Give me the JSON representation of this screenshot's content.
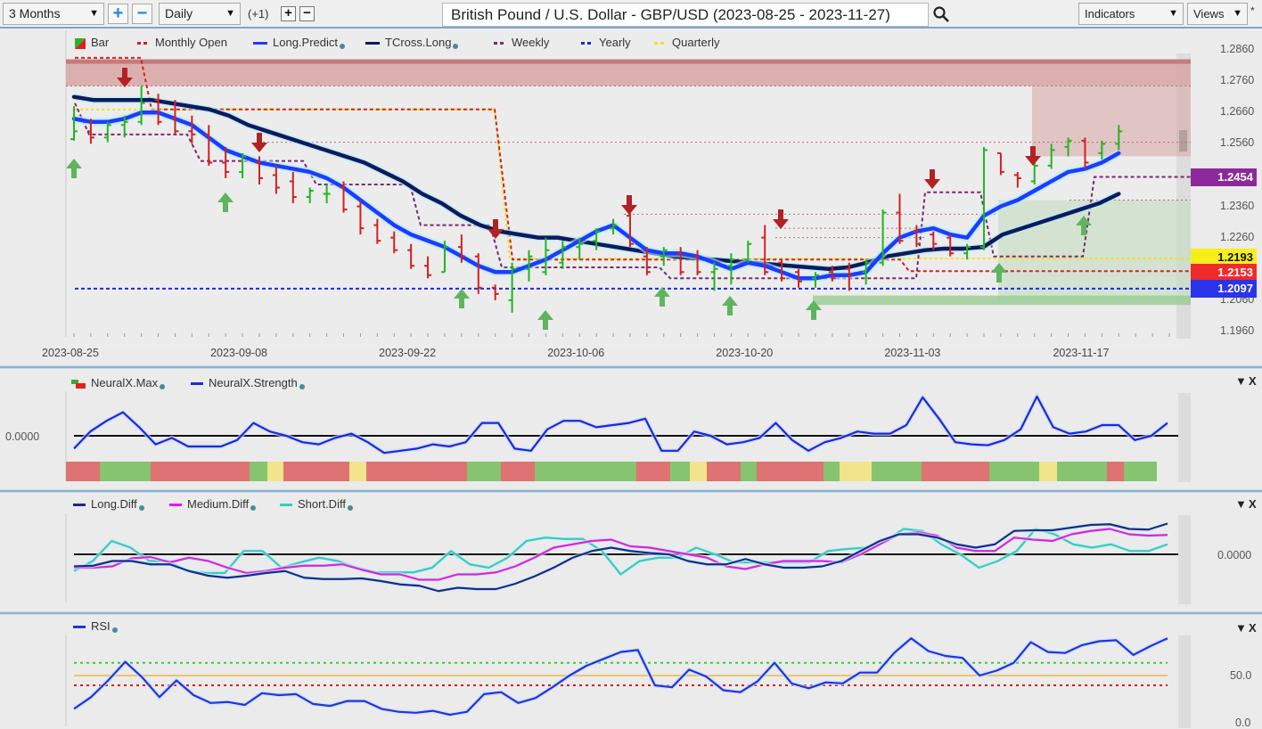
{
  "toolbar": {
    "range_select": "3 Months",
    "interval_select": "Daily",
    "offset_label": "(+1)",
    "title": "British Pound / U.S. Dollar - GBP/USD (2023-08-25 - 2023-11-27)",
    "indicators_label": "Indicators",
    "views_label": "Views",
    "star": "*",
    "plus": "+",
    "minus": "−"
  },
  "colors": {
    "bar_up": "#22b522",
    "bar_down": "#d42020",
    "long_predict": "#1e3cff",
    "tcross_long": "#0e1a5e",
    "monthly_open": "#d42020",
    "weekly": "#7a2a6e",
    "yearly": "#1a2ad8",
    "quarterly": "#f2e21a",
    "neural_green": "#86c46f",
    "neural_red": "#df7272",
    "neural_yellow": "#f1e48a",
    "long_diff": "#1a2a8a",
    "medium_diff": "#e020e0",
    "short_diff": "#3cc8c0",
    "rsi": "#2233dd"
  },
  "main_legend": [
    {
      "label": "Bar",
      "kind": "bar"
    },
    {
      "label": "Monthly Open",
      "kind": "dash",
      "color": "#d42020"
    },
    {
      "label": "Long.Predict",
      "kind": "line",
      "color": "#1e3cff",
      "dot": true
    },
    {
      "label": "TCross.Long",
      "kind": "line",
      "color": "#0e1a5e",
      "dot": true
    },
    {
      "label": "Weekly",
      "kind": "dash",
      "color": "#7a2a6e"
    },
    {
      "label": "Yearly",
      "kind": "dash",
      "color": "#1a2ad8"
    },
    {
      "label": "Quarterly",
      "kind": "dash",
      "color": "#f2e21a"
    }
  ],
  "price_tags": [
    {
      "value": "1.2454",
      "bg": "#8c2a9c",
      "fg": "#ffffff"
    },
    {
      "value": "1.2193",
      "bg": "#f8ee1a",
      "fg": "#111111"
    },
    {
      "value": "1.2153",
      "bg": "#ee2a2a",
      "fg": "#ffffff"
    },
    {
      "value": "1.2097",
      "bg": "#2a34e8",
      "fg": "#ffffff"
    }
  ],
  "neural_legend": [
    {
      "label": "NeuralX.Max",
      "kind": "max"
    },
    {
      "label": "NeuralX.Strength",
      "kind": "line",
      "color": "#1a2ad8"
    }
  ],
  "diff_legend": [
    {
      "label": "Long.Diff",
      "color": "#1a2a8a"
    },
    {
      "label": "Medium.Diff",
      "color": "#e020e0"
    },
    {
      "label": "Short.Diff",
      "color": "#3cc8c0"
    }
  ],
  "rsi_legend": [
    {
      "label": "RSI",
      "color": "#2233dd"
    }
  ],
  "panel_controls": {
    "collapse": "▼",
    "close": "X"
  },
  "chart_data": [
    {
      "type": "ohlc",
      "title": "British Pound / U.S. Dollar - GBP/USD (2023-08-25 - 2023-11-27)",
      "ylim": [
        1.192,
        1.29
      ],
      "yticks": [
        "1.2860",
        "1.2760",
        "1.2660",
        "1.2560",
        "1.2454",
        "1.2360",
        "1.2260",
        "1.2193",
        "1.2153",
        "1.2097",
        "1.2060",
        "1.1960"
      ],
      "ytick_values": [
        1.286,
        1.276,
        1.266,
        1.256,
        1.236,
        1.226,
        1.206,
        1.196
      ],
      "xticks": [
        "2023-08-25",
        "2023-09-08",
        "2023-09-22",
        "2023-10-06",
        "2023-10-20",
        "2023-11-03",
        "2023-11-17"
      ],
      "xtick_index": [
        0,
        10,
        20,
        30,
        40,
        50,
        60
      ],
      "n_bars": 66,
      "bars": [
        [
          1.2575,
          1.268,
          1.257,
          1.26
        ],
        [
          1.26,
          1.264,
          1.256,
          1.258
        ],
        [
          1.258,
          1.263,
          1.2565,
          1.262
        ],
        [
          1.262,
          1.265,
          1.258,
          1.263
        ],
        [
          1.263,
          1.2745,
          1.262,
          1.269
        ],
        [
          1.27,
          1.272,
          1.262,
          1.263
        ],
        [
          1.264,
          1.27,
          1.259,
          1.26
        ],
        [
          1.26,
          1.265,
          1.256,
          1.259
        ],
        [
          1.259,
          1.262,
          1.249,
          1.25
        ],
        [
          1.25,
          1.255,
          1.245,
          1.247
        ],
        [
          1.247,
          1.253,
          1.245,
          1.252
        ],
        [
          1.25,
          1.252,
          1.243,
          1.245
        ],
        [
          1.246,
          1.249,
          1.24,
          1.242
        ],
        [
          1.244,
          1.247,
          1.237,
          1.239
        ],
        [
          1.239,
          1.242,
          1.237,
          1.241
        ],
        [
          1.24,
          1.243,
          1.237,
          1.24
        ],
        [
          1.242,
          1.244,
          1.234,
          1.235
        ],
        [
          1.236,
          1.238,
          1.227,
          1.229
        ],
        [
          1.23,
          1.232,
          1.224,
          1.225
        ],
        [
          1.226,
          1.228,
          1.221,
          1.222
        ],
        [
          1.222,
          1.224,
          1.216,
          1.217
        ],
        [
          1.217,
          1.22,
          1.213,
          1.214
        ],
        [
          1.215,
          1.225,
          1.215,
          1.223
        ],
        [
          1.223,
          1.227,
          1.218,
          1.22
        ],
        [
          1.22,
          1.221,
          1.208,
          1.21
        ],
        [
          1.21,
          1.211,
          1.206,
          1.208
        ],
        [
          1.206,
          1.218,
          1.202,
          1.216
        ],
        [
          1.216,
          1.222,
          1.212,
          1.22
        ],
        [
          1.215,
          1.226,
          1.214,
          1.222
        ],
        [
          1.218,
          1.225,
          1.216,
          1.223
        ],
        [
          1.223,
          1.226,
          1.219,
          1.224
        ],
        [
          1.225,
          1.229,
          1.222,
          1.228
        ],
        [
          1.229,
          1.232,
          1.227,
          1.23
        ],
        [
          1.233,
          1.236,
          1.223,
          1.224
        ],
        [
          1.22,
          1.223,
          1.214,
          1.215
        ],
        [
          1.22,
          1.223,
          1.217,
          1.222
        ],
        [
          1.221,
          1.223,
          1.214,
          1.215
        ],
        [
          1.22,
          1.222,
          1.214,
          1.215
        ],
        [
          1.215,
          1.218,
          1.209,
          1.216
        ],
        [
          1.217,
          1.221,
          1.211,
          1.219
        ],
        [
          1.219,
          1.225,
          1.218,
          1.224
        ],
        [
          1.226,
          1.23,
          1.214,
          1.215
        ],
        [
          1.218,
          1.219,
          1.212,
          1.213
        ],
        [
          1.215,
          1.216,
          1.21,
          1.212
        ],
        [
          1.213,
          1.215,
          1.21,
          1.214
        ],
        [
          1.215,
          1.217,
          1.212,
          1.213
        ],
        [
          1.216,
          1.218,
          1.209,
          1.214
        ],
        [
          1.215,
          1.219,
          1.211,
          1.218
        ],
        [
          1.218,
          1.235,
          1.217,
          1.234
        ],
        [
          1.234,
          1.24,
          1.224,
          1.225
        ],
        [
          1.228,
          1.23,
          1.223,
          1.224
        ],
        [
          1.227,
          1.228,
          1.222,
          1.224
        ],
        [
          1.226,
          1.227,
          1.22,
          1.221
        ],
        [
          1.221,
          1.224,
          1.219,
          1.223
        ],
        [
          1.223,
          1.255,
          1.222,
          1.254
        ],
        [
          1.253,
          1.253,
          1.246,
          1.247
        ],
        [
          1.246,
          1.247,
          1.242,
          1.245
        ],
        [
          1.244,
          1.25,
          1.243,
          1.249
        ],
        [
          1.249,
          1.256,
          1.248,
          1.254
        ],
        [
          1.255,
          1.258,
          1.252,
          1.257
        ],
        [
          1.257,
          1.258,
          1.248,
          1.25
        ],
        [
          1.253,
          1.257,
          1.251,
          1.256
        ],
        [
          1.256,
          1.262,
          1.254,
          1.26
        ]
      ],
      "long_predict": [
        1.264,
        1.263,
        1.263,
        1.264,
        1.266,
        1.266,
        1.264,
        1.262,
        1.258,
        1.254,
        1.252,
        1.25,
        1.249,
        1.248,
        1.247,
        1.245,
        1.242,
        1.238,
        1.234,
        1.23,
        1.227,
        1.225,
        1.223,
        1.22,
        1.217,
        1.215,
        1.215,
        1.217,
        1.219,
        1.222,
        1.225,
        1.228,
        1.23,
        1.226,
        1.222,
        1.221,
        1.221,
        1.22,
        1.218,
        1.216,
        1.218,
        1.217,
        1.215,
        1.213,
        1.213,
        1.214,
        1.214,
        1.215,
        1.221,
        1.226,
        1.228,
        1.229,
        1.227,
        1.226,
        1.233,
        1.236,
        1.238,
        1.241,
        1.244,
        1.247,
        1.248,
        1.25,
        1.253
      ],
      "tcross_long": [
        1.271,
        1.27,
        1.27,
        1.27,
        1.27,
        1.269,
        1.268,
        1.267,
        1.265,
        1.262,
        1.26,
        1.258,
        1.256,
        1.254,
        1.252,
        1.25,
        1.247,
        1.244,
        1.24,
        1.237,
        1.233,
        1.23,
        1.228,
        1.227,
        1.226,
        1.226,
        1.225,
        1.224,
        1.223,
        1.222,
        1.221,
        1.22,
        1.2195,
        1.219,
        1.2185,
        1.218,
        1.2175,
        1.217,
        1.2165,
        1.216,
        1.2165,
        1.218,
        1.22,
        1.221,
        1.222,
        1.2225,
        1.2225,
        1.223,
        1.227,
        1.229,
        1.231,
        1.233,
        1.235,
        1.237,
        1.24
      ],
      "levels": {
        "weekly": 1.2454,
        "quarterly": 1.2193,
        "monthly_open": 1.2153,
        "yearly": 1.2097
      },
      "series": [
        "Bar",
        "Monthly Open",
        "Long.Predict",
        "TCross.Long",
        "Weekly",
        "Yearly",
        "Quarterly"
      ]
    },
    {
      "type": "line+heatstrip",
      "name": "NeuralX",
      "legend": [
        "NeuralX.Max",
        "NeuralX.Strength"
      ],
      "yticks": [
        "0.0000"
      ],
      "ylim": [
        -1,
        1.5
      ],
      "strength": [
        -0.3,
        0.1,
        0.35,
        0.55,
        0.2,
        -0.2,
        -0.05,
        -0.25,
        -0.25,
        -0.25,
        -0.1,
        0.3,
        0.1,
        0.0,
        -0.15,
        -0.2,
        -0.05,
        0.05,
        -0.15,
        -0.4,
        -0.35,
        -0.3,
        -0.2,
        -0.25,
        -0.15,
        0.3,
        0.3,
        -0.3,
        -0.35,
        0.15,
        0.35,
        0.35,
        0.2,
        0.25,
        0.3,
        0.4,
        -0.35,
        -0.35,
        0.1,
        0.0,
        -0.2,
        -0.15,
        -0.05,
        0.3,
        -0.1,
        -0.35,
        -0.15,
        -0.05,
        0.1,
        0.05,
        0.05,
        0.25,
        0.9,
        0.4,
        -0.15,
        -0.2,
        -0.22,
        -0.1,
        0.15,
        0.92,
        0.2,
        0.05,
        0.1,
        0.25,
        0.25,
        -0.1,
        0.0,
        0.3
      ],
      "strip": [
        "red",
        "green",
        "red",
        "green",
        "yellow",
        "red",
        "yellow",
        "red",
        "green",
        "red",
        "green",
        "red",
        "green",
        "yellow",
        "red",
        "green",
        "red",
        "green",
        "yellow",
        "green",
        "red",
        "green",
        "yellow",
        "green",
        "red",
        "green"
      ],
      "strip_widths": [
        38,
        57,
        111,
        20,
        18,
        74,
        19,
        113,
        38,
        38,
        114,
        38,
        22,
        19,
        38,
        18,
        75,
        18,
        36,
        56,
        76,
        56,
        20,
        56,
        19,
        37
      ]
    },
    {
      "type": "line",
      "name": "Diff",
      "legend": [
        "Long.Diff",
        "Medium.Diff",
        "Short.Diff"
      ],
      "yticks": [
        "0.0000"
      ],
      "ylim": [
        -1,
        1
      ],
      "long_diff": [
        -0.18,
        -0.17,
        -0.1,
        -0.1,
        -0.15,
        -0.15,
        -0.25,
        -0.32,
        -0.35,
        -0.32,
        -0.28,
        -0.25,
        -0.35,
        -0.37,
        -0.37,
        -0.36,
        -0.4,
        -0.45,
        -0.47,
        -0.55,
        -0.5,
        -0.52,
        -0.52,
        -0.44,
        -0.33,
        -0.2,
        -0.05,
        0.05,
        0.1,
        0.05,
        0.02,
        0.0,
        -0.1,
        -0.15,
        -0.15,
        -0.07,
        -0.15,
        -0.2,
        -0.2,
        -0.18,
        -0.1,
        0.05,
        0.2,
        0.3,
        0.3,
        0.25,
        0.15,
        0.1,
        0.15,
        0.35,
        0.36,
        0.36,
        0.4,
        0.44,
        0.45,
        0.38,
        0.37,
        0.46
      ],
      "medium_diff": [
        -0.2,
        -0.2,
        -0.18,
        -0.06,
        -0.04,
        -0.12,
        -0.05,
        -0.1,
        -0.2,
        -0.28,
        -0.25,
        -0.2,
        -0.17,
        -0.17,
        -0.15,
        -0.23,
        -0.3,
        -0.3,
        -0.38,
        -0.38,
        -0.3,
        -0.3,
        -0.27,
        -0.18,
        -0.05,
        0.1,
        0.15,
        0.2,
        0.22,
        0.12,
        0.1,
        0.05,
        0.0,
        -0.05,
        -0.18,
        -0.22,
        -0.15,
        -0.1,
        -0.1,
        -0.1,
        -0.12,
        0.0,
        0.15,
        0.3,
        0.33,
        0.28,
        0.1,
        0.05,
        0.05,
        0.25,
        0.22,
        0.2,
        0.3,
        0.35,
        0.38,
        0.3,
        0.28,
        0.29
      ],
      "short_diff": [
        -0.25,
        -0.1,
        0.2,
        0.1,
        -0.1,
        -0.1,
        -0.25,
        -0.28,
        -0.28,
        0.05,
        0.05,
        -0.2,
        -0.12,
        -0.05,
        -0.1,
        -0.2,
        -0.27,
        -0.27,
        -0.27,
        -0.2,
        0.05,
        -0.15,
        -0.2,
        -0.05,
        0.2,
        0.25,
        0.23,
        0.23,
        0.05,
        -0.3,
        -0.1,
        -0.05,
        -0.05,
        0.1,
        0.0,
        -0.12,
        -0.12,
        -0.12,
        -0.12,
        -0.12,
        0.05,
        0.08,
        0.1,
        0.2,
        0.38,
        0.35,
        0.15,
        0.0,
        -0.2,
        -0.1,
        0.05,
        0.38,
        0.3,
        0.15,
        0.1,
        0.15,
        0.05,
        0.05,
        0.15
      ]
    },
    {
      "type": "line",
      "name": "RSI",
      "legend": [
        "RSI"
      ],
      "yticks": [
        "50.0",
        "0.0"
      ],
      "ylim": [
        0,
        100
      ],
      "levels": {
        "upper": 63,
        "mid": 50,
        "lower": 40
      },
      "rsi": [
        16,
        28,
        45,
        64,
        48,
        28,
        45,
        30,
        22,
        23,
        20,
        32,
        30,
        31,
        21,
        19,
        24,
        24,
        16,
        13,
        12,
        14,
        10,
        13,
        31,
        33,
        22,
        27,
        38,
        50,
        60,
        67,
        74,
        76,
        40,
        38,
        56,
        49,
        35,
        33,
        44,
        63,
        42,
        37,
        43,
        42,
        53,
        53,
        73,
        88,
        75,
        70,
        68,
        50,
        55,
        63,
        84,
        74,
        73,
        81,
        85,
        86,
        71,
        80,
        88
      ]
    }
  ]
}
